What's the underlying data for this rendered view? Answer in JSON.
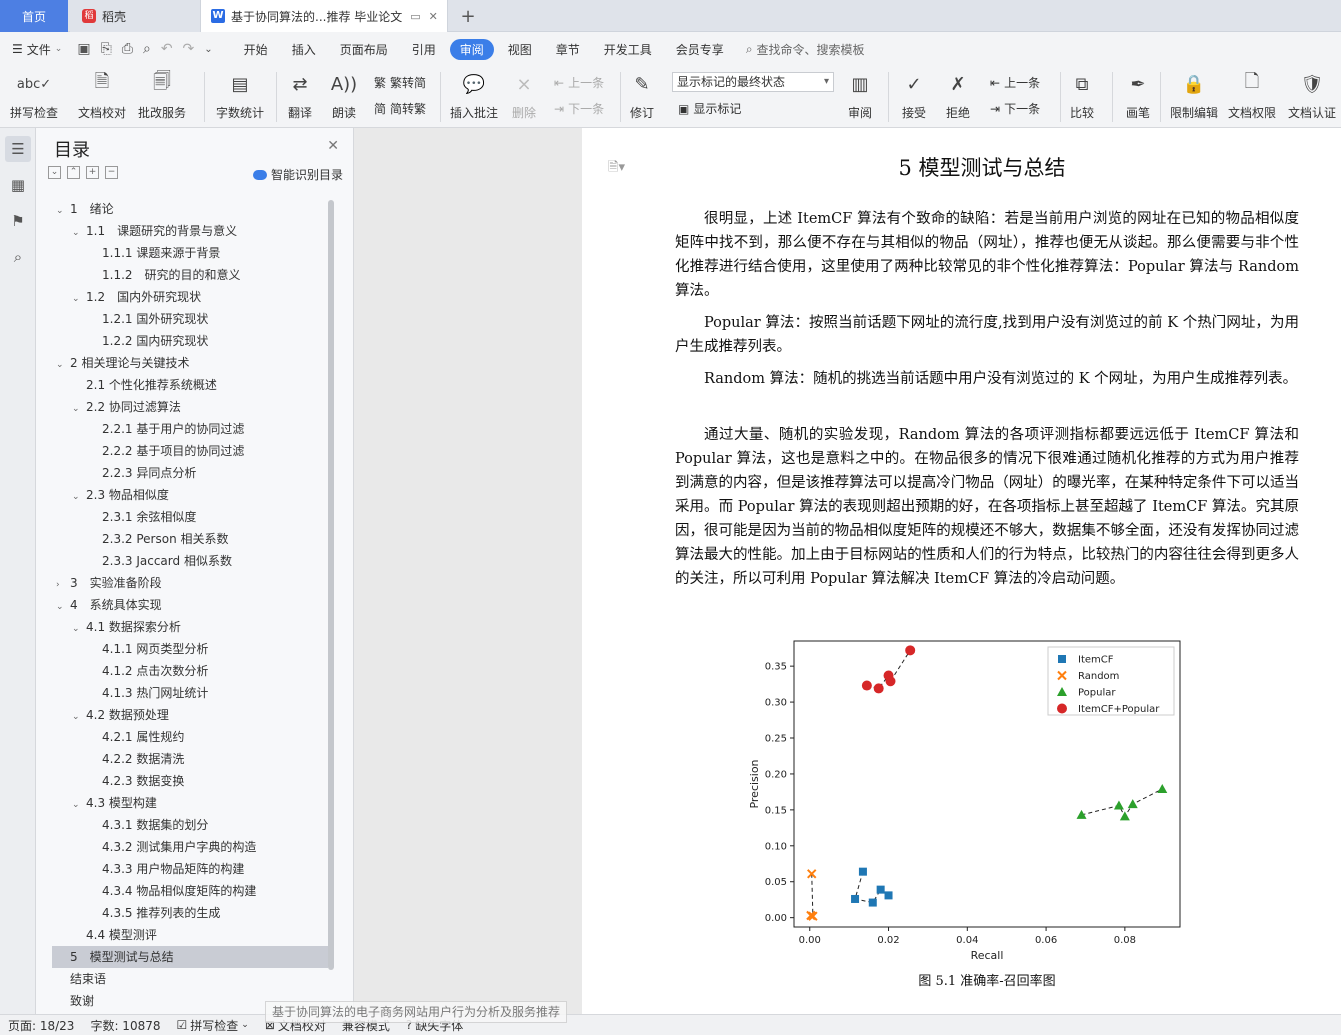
{
  "tabs": {
    "home": "首页",
    "daoke": "稻壳",
    "doc": "基于协同算法的...推荐 毕业论文"
  },
  "menu": {
    "file": "文件",
    "items": [
      "开始",
      "插入",
      "页面布局",
      "引用",
      "审阅",
      "视图",
      "章节",
      "开发工具",
      "会员专享"
    ],
    "active": "审阅",
    "search": "查找命令、搜索模板"
  },
  "ribbon": {
    "spell": "拼写检查",
    "proof": "文档校对",
    "annotate": "批改服务",
    "wordcount": "字数统计",
    "translate": "翻译",
    "read": "朗读",
    "trad": "繁转简",
    "simp": "简转繁",
    "insert_comment": "插入批注",
    "delete": "删除",
    "prev": "上一条",
    "next": "下一条",
    "revise": "修订",
    "markup_state": "显示标记的最终状态",
    "show_markup": "显示标记",
    "review": "审阅",
    "accept": "接受",
    "reject": "拒绝",
    "prev2": "上一条",
    "next2": "下一条",
    "compare": "比较",
    "pen": "画笔",
    "restrict": "限制编辑",
    "perm": "文档权限",
    "auth": "文档认证"
  },
  "toc": {
    "title": "目录",
    "ai": "智能识别目录",
    "items": [
      {
        "label": "1　绪论",
        "level": 0,
        "arrow": "⌄"
      },
      {
        "label": "1.1　课题研究的背景与意义",
        "level": 1,
        "arrow": "⌄"
      },
      {
        "label": "1.1.1 课题来源于背景",
        "level": 2,
        "arrow": ""
      },
      {
        "label": "1.1.2　研究的目的和意义",
        "level": 2,
        "arrow": ""
      },
      {
        "label": "1.2　国内外研究现状",
        "level": 1,
        "arrow": "⌄"
      },
      {
        "label": "1.2.1 国外研究现状",
        "level": 2,
        "arrow": ""
      },
      {
        "label": "1.2.2 国内研究现状",
        "level": 2,
        "arrow": ""
      },
      {
        "label": "2 相关理论与关键技术",
        "level": 0,
        "arrow": "⌄"
      },
      {
        "label": "2.1 个性化推荐系统概述",
        "level": 1,
        "arrow": ""
      },
      {
        "label": "2.2 协同过滤算法",
        "level": 1,
        "arrow": "⌄"
      },
      {
        "label": "2.2.1 基于用户的协同过滤",
        "level": 2,
        "arrow": ""
      },
      {
        "label": "2.2.2 基于项目的协同过滤",
        "level": 2,
        "arrow": ""
      },
      {
        "label": "2.2.3 异同点分析",
        "level": 2,
        "arrow": ""
      },
      {
        "label": "2.3 物品相似度",
        "level": 1,
        "arrow": "⌄"
      },
      {
        "label": "2.3.1 余弦相似度",
        "level": 2,
        "arrow": ""
      },
      {
        "label": "2.3.2 Person 相关系数",
        "level": 2,
        "arrow": ""
      },
      {
        "label": "2.3.3 Jaccard 相似系数",
        "level": 2,
        "arrow": ""
      },
      {
        "label": "3　实验准备阶段",
        "level": 0,
        "arrow": "›"
      },
      {
        "label": "4　系统具体实现",
        "level": 0,
        "arrow": "⌄"
      },
      {
        "label": "4.1 数据探索分析",
        "level": 1,
        "arrow": "⌄"
      },
      {
        "label": "4.1.1 网页类型分析",
        "level": 2,
        "arrow": ""
      },
      {
        "label": "4.1.2 点击次数分析",
        "level": 2,
        "arrow": ""
      },
      {
        "label": "4.1.3 热门网址统计",
        "level": 2,
        "arrow": ""
      },
      {
        "label": "4.2 数据预处理",
        "level": 1,
        "arrow": "⌄"
      },
      {
        "label": "4.2.1 属性规约",
        "level": 2,
        "arrow": ""
      },
      {
        "label": "4.2.2 数据清洗",
        "level": 2,
        "arrow": ""
      },
      {
        "label": "4.2.3 数据变换",
        "level": 2,
        "arrow": ""
      },
      {
        "label": "4.3 模型构建",
        "level": 1,
        "arrow": "⌄"
      },
      {
        "label": "4.3.1 数据集的划分",
        "level": 2,
        "arrow": ""
      },
      {
        "label": "4.3.2 测试集用户字典的构造",
        "level": 2,
        "arrow": ""
      },
      {
        "label": "4.3.3 用户物品矩阵的构建",
        "level": 2,
        "arrow": ""
      },
      {
        "label": "4.3.4 物品相似度矩阵的构建",
        "level": 2,
        "arrow": ""
      },
      {
        "label": "4.3.5 推荐列表的生成",
        "level": 2,
        "arrow": ""
      },
      {
        "label": "4.4 模型测评",
        "level": 1,
        "arrow": ""
      },
      {
        "label": "5　模型测试与总结",
        "level": 0,
        "arrow": "",
        "active": true
      },
      {
        "label": "结束语",
        "level": 0,
        "arrow": ""
      },
      {
        "label": "致谢",
        "level": 0,
        "arrow": ""
      }
    ]
  },
  "doc": {
    "heading": "5  模型测试与总结",
    "p1": "很明显，上述 ItemCF 算法有个致命的缺陷：若是当前用户浏览的网址在已知的物品相似度矩阵中找不到，那么便不存在与其相似的物品（网址），推荐也便无从谈起。那么便需要与非个性化推荐进行结合使用，这里使用了两种比较常见的非个性化推荐算法：Popular 算法与 Random 算法。",
    "p2": "Popular 算法：按照当前话题下网址的流行度,找到用户没有浏览过的前 K 个热门网址，为用户生成推荐列表。",
    "p3": "Random 算法：随机的挑选当前话题中用户没有浏览过的 K 个网址，为用户生成推荐列表。",
    "p4": "通过大量、随机的实验发现，Random 算法的各项评测指标都要远远低于 ItemCF 算法和 Popular 算法，这也是意料之中的。在物品很多的情况下很难通过随机化推荐的方式为用户推荐到满意的内容，但是该推荐算法可以提高冷门物品（网址）的曝光率，在某种特定条件下可以适当采用。而 Popular 算法的表现则超出预期的好，在各项指标上甚至超越了 ItemCF 算法。究其原因，很可能是因为当前的物品相似度矩阵的规模还不够大，数据集不够全面，还没有发挥协同过滤算法最大的性能。加上由于目标网站的性质和人们的行为特点，比较热门的内容往往会得到更多人的关注，所以可利用 Popular 算法解决 ItemCF 算法的冷启动问题。",
    "caption": "图 5.1  准确率-召回率图"
  },
  "chart_data": {
    "type": "scatter",
    "xlabel": "Recall",
    "ylabel": "Precision",
    "xlim": [
      -0.004,
      0.094
    ],
    "ylim": [
      -0.013,
      0.385
    ],
    "xticks": [
      "0.00",
      "0.02",
      "0.04",
      "0.06",
      "0.08"
    ],
    "yticks": [
      "0.00",
      "0.05",
      "0.10",
      "0.15",
      "0.20",
      "0.25",
      "0.30",
      "0.35"
    ],
    "legend_position": "top-right",
    "series": [
      {
        "name": "ItemCF",
        "marker": "square",
        "color": "#1f77b4",
        "points": [
          [
            0.0135,
            0.064
          ],
          [
            0.0115,
            0.026
          ],
          [
            0.016,
            0.021
          ],
          [
            0.018,
            0.039
          ],
          [
            0.02,
            0.031
          ]
        ]
      },
      {
        "name": "Random",
        "marker": "x",
        "color": "#ff7f0e",
        "points": [
          [
            0.0005,
            0.061
          ],
          [
            0.0008,
            0.002
          ],
          [
            0.0003,
            0.003
          ]
        ]
      },
      {
        "name": "Popular",
        "marker": "triangle",
        "color": "#2ca02c",
        "points": [
          [
            0.069,
            0.143
          ],
          [
            0.0785,
            0.156
          ],
          [
            0.08,
            0.141
          ],
          [
            0.082,
            0.158
          ],
          [
            0.0895,
            0.179
          ]
        ]
      },
      {
        "name": "ItemCF+Popular",
        "marker": "circle",
        "color": "#d62728",
        "points": [
          [
            0.0145,
            0.323
          ],
          [
            0.0175,
            0.319
          ],
          [
            0.02,
            0.337
          ],
          [
            0.0205,
            0.329
          ],
          [
            0.0255,
            0.372
          ]
        ]
      }
    ]
  },
  "status": {
    "page": "页面: 18/23",
    "words": "字数: 10878",
    "spell": "拼写检查",
    "proof": "文档校对",
    "compat": "兼容模式",
    "font": "缺失字体",
    "tooltip": "基于协同算法的电子商务网站用户行为分析及服务推荐"
  }
}
